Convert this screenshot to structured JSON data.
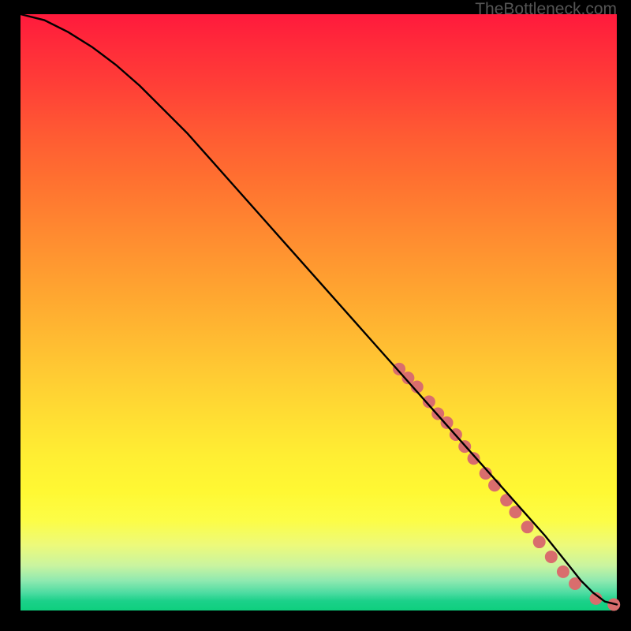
{
  "attribution": "TheBottleneck.com",
  "chart_data": {
    "type": "line",
    "title": "",
    "xlabel": "",
    "ylabel": "",
    "xlim": [
      0,
      100
    ],
    "ylim": [
      0,
      100
    ],
    "grid": false,
    "legend": false,
    "series": [
      {
        "name": "bottleneck-curve",
        "x": [
          0,
          4,
          8,
          12,
          16,
          20,
          24,
          28,
          32,
          36,
          40,
          44,
          48,
          52,
          56,
          60,
          64,
          68,
          72,
          76,
          80,
          84,
          88,
          92,
          94,
          96,
          98,
          100
        ],
        "y": [
          100,
          99,
          97,
          94.5,
          91.5,
          88,
          84,
          80,
          75.5,
          71,
          66.5,
          62,
          57.5,
          53,
          48.5,
          44,
          39.5,
          35,
          30.5,
          26,
          21.5,
          17,
          12.5,
          7.5,
          5,
          3,
          1.5,
          1
        ],
        "color": "#000000",
        "linewidth": 2
      }
    ],
    "markers": {
      "name": "highlighted-points",
      "color": "#d96d6d",
      "radius_px": 8,
      "points_xy": [
        [
          63.5,
          40.5
        ],
        [
          65,
          39
        ],
        [
          66.5,
          37.5
        ],
        [
          68.5,
          35
        ],
        [
          70,
          33
        ],
        [
          71.5,
          31.5
        ],
        [
          73,
          29.5
        ],
        [
          74.5,
          27.5
        ],
        [
          76,
          25.5
        ],
        [
          78,
          23
        ],
        [
          79.5,
          21
        ],
        [
          81.5,
          18.5
        ],
        [
          83,
          16.5
        ],
        [
          85,
          14
        ],
        [
          87,
          11.5
        ],
        [
          89,
          9
        ],
        [
          91,
          6.5
        ],
        [
          93,
          4.5
        ],
        [
          96.5,
          2
        ],
        [
          99.5,
          1
        ]
      ]
    }
  }
}
